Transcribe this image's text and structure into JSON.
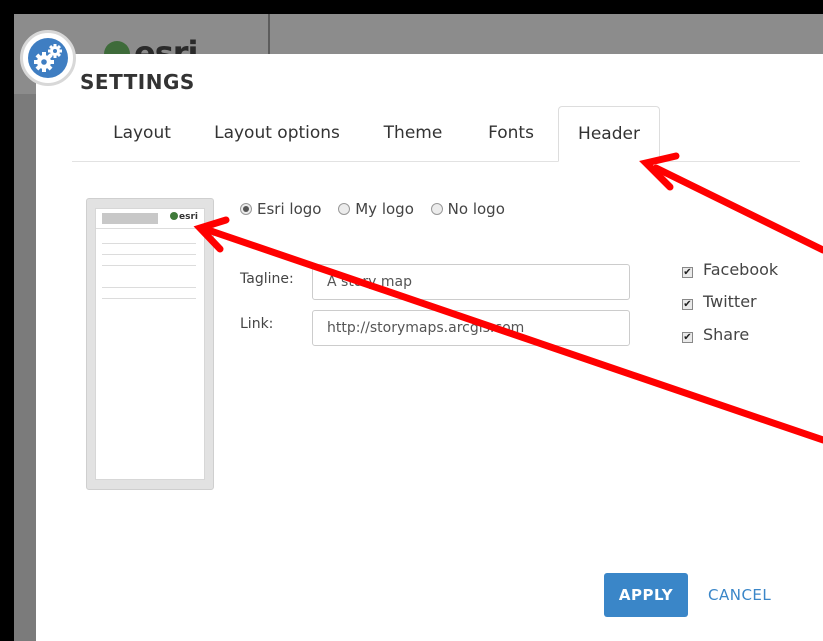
{
  "background": {
    "app_logo_text": "esri"
  },
  "dialog": {
    "title": "SETTINGS",
    "tabs": [
      {
        "label": "Layout",
        "active": false
      },
      {
        "label": "Layout options",
        "active": false
      },
      {
        "label": "Theme",
        "active": false
      },
      {
        "label": "Fonts",
        "active": false
      },
      {
        "label": "Header",
        "active": true
      }
    ],
    "preview": {
      "logo_text": "esri"
    },
    "logo_options": [
      {
        "label": "Esri logo",
        "checked": true
      },
      {
        "label": "My logo",
        "checked": false
      },
      {
        "label": "No logo",
        "checked": false
      }
    ],
    "tagline": {
      "label": "Tagline:",
      "value": "A story map"
    },
    "link": {
      "label": "Link:",
      "value": "http://storymaps.arcgis.com"
    },
    "social": [
      {
        "label": "Facebook",
        "checked": true
      },
      {
        "label": "Twitter",
        "checked": true
      },
      {
        "label": "Share",
        "checked": true
      }
    ],
    "apply_label": "APPLY",
    "cancel_label": "CANCEL"
  },
  "colors": {
    "accent": "#3a86c8",
    "annotation": "#ff0000"
  }
}
